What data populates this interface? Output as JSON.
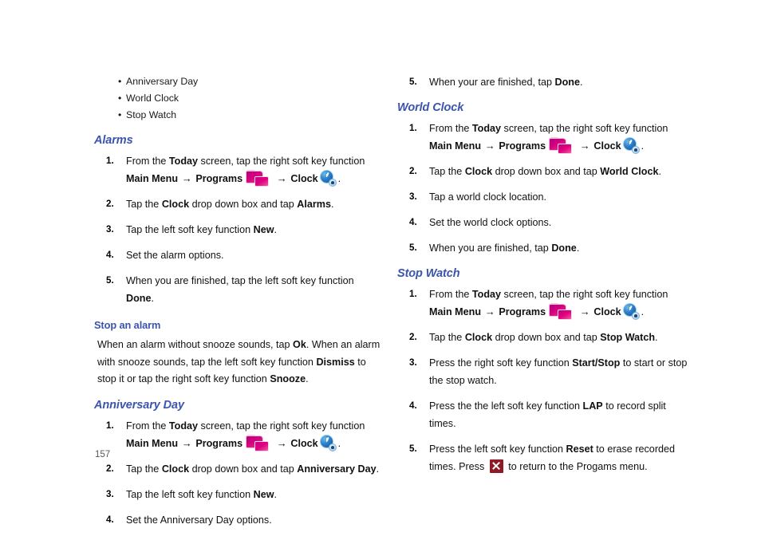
{
  "page": {
    "number": "157",
    "heading_color": "#3B54AD",
    "icon_colors": {
      "programs_folder": "#d6007f",
      "clock": "#2a7fc8",
      "close_button": "#8e1a25"
    }
  },
  "icons": {
    "programs": "programs-folder-icon",
    "clock": "clock-icon",
    "close": "close-x-icon",
    "arrow": "→",
    "bullet": "•"
  },
  "left_column": {
    "bullet_list": {
      "items": [
        "Anniversary Day",
        "World Clock",
        "Stop Watch"
      ]
    },
    "alarms": {
      "heading": "Alarms",
      "steps": [
        {
          "num": "1.",
          "parts": [
            {
              "t": "From the ",
              "b": false
            },
            {
              "t": "Today",
              "b": true
            },
            {
              "t": " screen, tap the right soft key function ",
              "b": false
            },
            {
              "t": "Main Menu",
              "b": true
            },
            {
              "t": " → ",
              "b": true
            },
            {
              "t": "Programs",
              "b": true
            },
            {
              "t": "[icon:programs]",
              "b": false
            },
            {
              "t": " → ",
              "b": true
            },
            {
              "t": "Clock",
              "b": true
            },
            {
              "t": "[icon:clock]",
              "b": false
            },
            {
              "t": ".",
              "b": false
            }
          ]
        },
        {
          "num": "2.",
          "parts": [
            {
              "t": "Tap the ",
              "b": false
            },
            {
              "t": "Clock",
              "b": true
            },
            {
              "t": " drop down box and tap ",
              "b": false
            },
            {
              "t": "Alarms",
              "b": true
            },
            {
              "t": ".",
              "b": false
            }
          ]
        },
        {
          "num": "3.",
          "parts": [
            {
              "t": "Tap the left soft key function ",
              "b": false
            },
            {
              "t": "New",
              "b": true
            },
            {
              "t": ".",
              "b": false
            }
          ]
        },
        {
          "num": "4.",
          "parts": [
            {
              "t": "Set the alarm options.",
              "b": false
            }
          ]
        },
        {
          "num": "5.",
          "parts": [
            {
              "t": "When you are finished, tap the left soft key function ",
              "b": false
            },
            {
              "t": "Done",
              "b": true
            },
            {
              "t": ".",
              "b": false
            }
          ]
        }
      ]
    },
    "stop_an_alarm": {
      "heading": "Stop an alarm",
      "paragraph_parts": [
        {
          "t": "When an alarm without snooze sounds, tap ",
          "b": false
        },
        {
          "t": "Ok",
          "b": true
        },
        {
          "t": ". When an alarm with snooze sounds, tap the left soft key function ",
          "b": false
        },
        {
          "t": "Dismiss",
          "b": true
        },
        {
          "t": " to stop it or tap the right soft key function ",
          "b": false
        },
        {
          "t": "Snooze",
          "b": true
        },
        {
          "t": ".",
          "b": false
        }
      ]
    },
    "anniversary_day": {
      "heading": "Anniversary Day",
      "steps": [
        {
          "num": "1.",
          "parts": [
            {
              "t": "From the ",
              "b": false
            },
            {
              "t": "Today",
              "b": true
            },
            {
              "t": " screen, tap the right soft key function ",
              "b": false
            },
            {
              "t": "Main Menu",
              "b": true
            },
            {
              "t": " → ",
              "b": true
            },
            {
              "t": "Programs",
              "b": true
            },
            {
              "t": "[icon:programs]",
              "b": false
            },
            {
              "t": " → ",
              "b": true
            },
            {
              "t": "Clock",
              "b": true
            },
            {
              "t": "[icon:clock]",
              "b": false
            },
            {
              "t": ".",
              "b": false
            }
          ]
        },
        {
          "num": "2.",
          "parts": [
            {
              "t": "Tap the ",
              "b": false
            },
            {
              "t": "Clock",
              "b": true
            },
            {
              "t": " drop down box and tap ",
              "b": false
            },
            {
              "t": "Anniversary Day",
              "b": true
            },
            {
              "t": ".",
              "b": false
            }
          ]
        },
        {
          "num": "3.",
          "parts": [
            {
              "t": "Tap the left soft key function ",
              "b": false
            },
            {
              "t": "New",
              "b": true
            },
            {
              "t": ".",
              "b": false
            }
          ]
        },
        {
          "num": "4.",
          "parts": [
            {
              "t": "Set the Anniversary Day options.",
              "b": false
            }
          ]
        }
      ]
    }
  },
  "right_column": {
    "continued_step": {
      "num": "5.",
      "parts": [
        {
          "t": "When your are finished, tap ",
          "b": false
        },
        {
          "t": "Done",
          "b": true
        },
        {
          "t": ".",
          "b": false
        }
      ]
    },
    "world_clock": {
      "heading": "World Clock",
      "steps": [
        {
          "num": "1.",
          "parts": [
            {
              "t": "From the ",
              "b": false
            },
            {
              "t": "Today",
              "b": true
            },
            {
              "t": " screen, tap the right soft key function ",
              "b": false
            },
            {
              "t": "Main Menu",
              "b": true
            },
            {
              "t": " → ",
              "b": true
            },
            {
              "t": "Programs",
              "b": true
            },
            {
              "t": "[icon:programs]",
              "b": false
            },
            {
              "t": " → ",
              "b": true
            },
            {
              "t": "Clock",
              "b": true
            },
            {
              "t": "[icon:clock]",
              "b": false
            },
            {
              "t": ".",
              "b": false
            }
          ]
        },
        {
          "num": "2.",
          "parts": [
            {
              "t": "Tap the ",
              "b": false
            },
            {
              "t": "Clock",
              "b": true
            },
            {
              "t": " drop down box and tap ",
              "b": false
            },
            {
              "t": "World Clock",
              "b": true
            },
            {
              "t": ".",
              "b": false
            }
          ]
        },
        {
          "num": "3.",
          "parts": [
            {
              "t": "Tap a world clock location.",
              "b": false
            }
          ]
        },
        {
          "num": "4.",
          "parts": [
            {
              "t": "Set the world clock options.",
              "b": false
            }
          ]
        },
        {
          "num": "5.",
          "parts": [
            {
              "t": "When you are finished, tap ",
              "b": false
            },
            {
              "t": "Done",
              "b": true
            },
            {
              "t": ".",
              "b": false
            }
          ]
        }
      ]
    },
    "stop_watch": {
      "heading": "Stop Watch",
      "steps": [
        {
          "num": "1.",
          "parts": [
            {
              "t": "From the ",
              "b": false
            },
            {
              "t": "Today",
              "b": true
            },
            {
              "t": " screen, tap the right soft key function ",
              "b": false
            },
            {
              "t": "Main Menu",
              "b": true
            },
            {
              "t": " → ",
              "b": true
            },
            {
              "t": "Programs",
              "b": true
            },
            {
              "t": "[icon:programs]",
              "b": false
            },
            {
              "t": " → ",
              "b": true
            },
            {
              "t": "Clock",
              "b": true
            },
            {
              "t": "[icon:clock]",
              "b": false
            },
            {
              "t": ".",
              "b": false
            }
          ]
        },
        {
          "num": "2.",
          "parts": [
            {
              "t": "Tap the ",
              "b": false
            },
            {
              "t": "Clock",
              "b": true
            },
            {
              "t": " drop down box and tap ",
              "b": false
            },
            {
              "t": "Stop Watch",
              "b": true
            },
            {
              "t": ".",
              "b": false
            }
          ]
        },
        {
          "num": "3.",
          "parts": [
            {
              "t": "Press the right soft key function ",
              "b": false
            },
            {
              "t": "Start/Stop",
              "b": true
            },
            {
              "t": " to start or stop the stop watch.",
              "b": false
            }
          ]
        },
        {
          "num": "4.",
          "parts": [
            {
              "t": "Press the the left soft key function ",
              "b": false
            },
            {
              "t": "LAP",
              "b": true
            },
            {
              "t": " to record split times.",
              "b": false
            }
          ]
        },
        {
          "num": "5.",
          "parts": [
            {
              "t": "Press the left soft key function ",
              "b": false
            },
            {
              "t": "Reset",
              "b": true
            },
            {
              "t": " to erase recorded times. Press ",
              "b": false
            },
            {
              "t": "[icon:close]",
              "b": false
            },
            {
              "t": " to return to the Progams menu.",
              "b": false
            }
          ]
        }
      ]
    }
  }
}
